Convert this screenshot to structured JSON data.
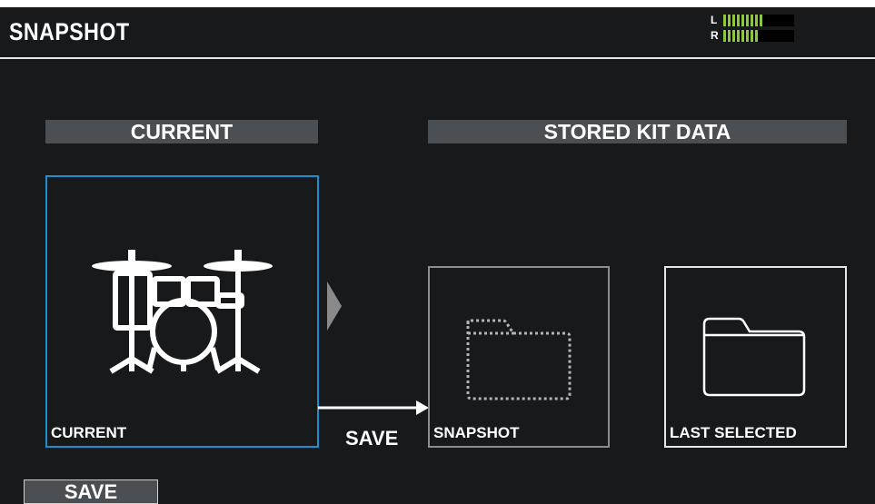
{
  "header": {
    "title": "SNAPSHOT"
  },
  "level_meter": {
    "left": {
      "label": "L",
      "level": 0.55
    },
    "right": {
      "label": "R",
      "level": 0.5
    },
    "color": "#8dc63f"
  },
  "sections": {
    "current_header": "CURRENT",
    "stored_header": "STORED KIT DATA"
  },
  "panels": {
    "current": {
      "label": "CURRENT",
      "icon": "drum-kit-icon",
      "selected": true,
      "border_color": "#1e8fd1"
    },
    "snapshot": {
      "label": "SNAPSHOT",
      "icon": "empty-folder-icon"
    },
    "last_selected": {
      "label": "LAST SELECTED",
      "icon": "folder-icon"
    }
  },
  "arrow": {
    "label": "SAVE"
  },
  "footer": {
    "save_button_label": "SAVE"
  },
  "colors": {
    "background": "#18191b",
    "section_header": "#4a4f53",
    "selection": "#1e8fd1"
  }
}
